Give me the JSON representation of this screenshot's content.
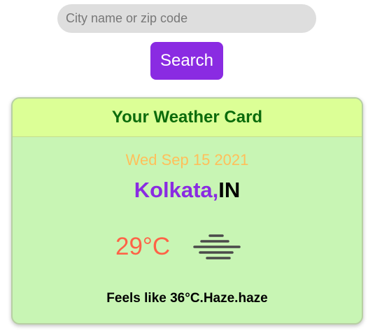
{
  "search": {
    "placeholder": "City name or zip code",
    "button_label": "Search"
  },
  "card": {
    "title": "Your Weather Card",
    "date": "Wed Sep 15 2021",
    "city": "Kolkata,",
    "country": "IN",
    "temperature": "29°C",
    "weather_icon": "haze-icon",
    "feels_like": "Feels like 36°C.Haze.haze"
  },
  "colors": {
    "accent": "#8a2be2",
    "card_bg": "#c8f5b4",
    "header_bg": "#dcff96",
    "title": "#0b6b0b",
    "date": "#ffbf5a",
    "temperature": "#ff6347"
  }
}
